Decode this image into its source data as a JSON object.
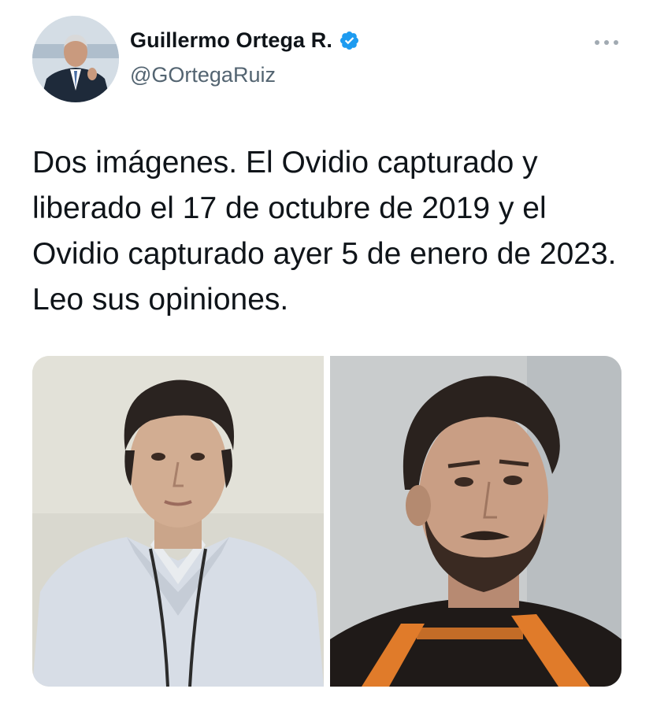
{
  "author": {
    "display_name": "Guillermo Ortega R.",
    "handle": "@GOrtegaRuiz",
    "verified": true,
    "avatar_icon": "profile-photo"
  },
  "tweet": {
    "text": "Dos imágenes. El Ovidio capturado y liberado el 17 de octubre de 2019 y el Ovidio capturado ayer 5 de enero de 2023. Leo sus opiniones."
  },
  "media": {
    "photos": [
      {
        "icon": "photo-man-light-shirt"
      },
      {
        "icon": "photo-man-bearded-orange-stripes"
      }
    ]
  },
  "colors": {
    "text": "#0f1419",
    "secondary": "#536471",
    "verified_badge": "#1d9bf0",
    "more_dots": "#a1aab2"
  }
}
